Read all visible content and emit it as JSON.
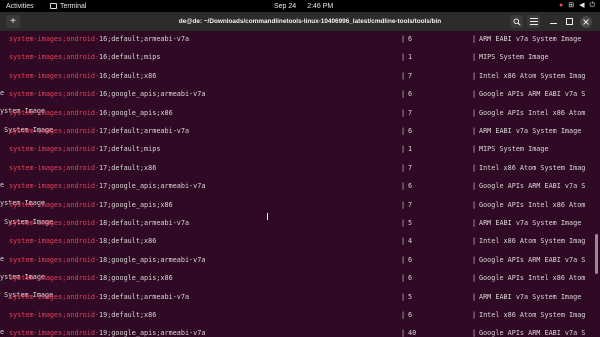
{
  "topbar": {
    "activities": "Activities",
    "app_name": "Terminal",
    "date": "Sep 24",
    "time": "2:46 PM"
  },
  "window": {
    "title": "de@de: ~/Downloads/commandlinetools-linux-10406996_latest/cmdline-tools/tools/bin"
  },
  "icons": {
    "new_tab": "+",
    "search": "search-icon",
    "menu": "hamburger-menu-icon",
    "minimize": "minimize-icon",
    "maximize": "maximize-icon",
    "close": "close-icon"
  },
  "colors": {
    "terminal_bg": "#300a24",
    "package_prefix": "#e5405a",
    "text": "#d8d8d8"
  },
  "rows": [
    {
      "prefix": "system-images;android-",
      "rest": "16;default;armeabi-v7a",
      "version": "6",
      "desc": "ARM EABI v7a System Image",
      "wrap": ""
    },
    {
      "prefix": "system-images;android-",
      "rest": "16;default;mips",
      "version": "1",
      "desc": "MIPS System Image",
      "wrap": ""
    },
    {
      "prefix": "system-images;android-",
      "rest": "16;default;x86",
      "version": "7",
      "desc": "Intel x86 Atom System Imag",
      "wrap": "e"
    },
    {
      "prefix": "system-images;android-",
      "rest": "16;google_apis;armeabi-v7a",
      "version": "6",
      "desc": "Google APIs ARM EABI v7a S",
      "wrap": "ystem Image"
    },
    {
      "prefix": "system-images;android-",
      "rest": "16;google_apis;x86",
      "version": "7",
      "desc": "Google APIs Intel x86 Atom",
      "wrap": " System Image"
    },
    {
      "prefix": "system-images;android-",
      "rest": "17;default;armeabi-v7a",
      "version": "6",
      "desc": "ARM EABI v7a System Image",
      "wrap": ""
    },
    {
      "prefix": "system-images;android-",
      "rest": "17;default;mips",
      "version": "1",
      "desc": "MIPS System Image",
      "wrap": ""
    },
    {
      "prefix": "system-images;android-",
      "rest": "17;default;x86",
      "version": "7",
      "desc": "Intel x86 Atom System Imag",
      "wrap": "e"
    },
    {
      "prefix": "system-images;android-",
      "rest": "17;google_apis;armeabi-v7a",
      "version": "6",
      "desc": "Google APIs ARM EABI v7a S",
      "wrap": "ystem Image"
    },
    {
      "prefix": "system-images;android-",
      "rest": "17;google_apis;x86",
      "version": "7",
      "desc": "Google APIs Intel x86 Atom",
      "wrap": " System Image"
    },
    {
      "prefix": "system-images;android-",
      "rest": "18;default;armeabi-v7a",
      "version": "5",
      "desc": "ARM EABI v7a System Image",
      "wrap": ""
    },
    {
      "prefix": "system-images;android-",
      "rest": "18;default;x86",
      "version": "4",
      "desc": "Intel x86 Atom System Imag",
      "wrap": "e"
    },
    {
      "prefix": "system-images;android-",
      "rest": "18;google_apis;armeabi-v7a",
      "version": "6",
      "desc": "Google APIs ARM EABI v7a S",
      "wrap": "ystem Image"
    },
    {
      "prefix": "system-images;android-",
      "rest": "18;google_apis;x86",
      "version": "6",
      "desc": "Google APIs Intel x86 Atom",
      "wrap": " System Image"
    },
    {
      "prefix": "system-images;android-",
      "rest": "19;default;armeabi-v7a",
      "version": "5",
      "desc": "ARM EABI v7a System Image",
      "wrap": ""
    },
    {
      "prefix": "system-images;android-",
      "rest": "19;default;x86",
      "version": "6",
      "desc": "Intel x86 Atom System Imag",
      "wrap": "e"
    },
    {
      "prefix": "system-images;android-",
      "rest": "19;google_apis;armeabi-v7a",
      "version": "40",
      "desc": "Google APIs ARM EABI v7a S",
      "wrap": ""
    }
  ],
  "cursor_glyph": "I"
}
